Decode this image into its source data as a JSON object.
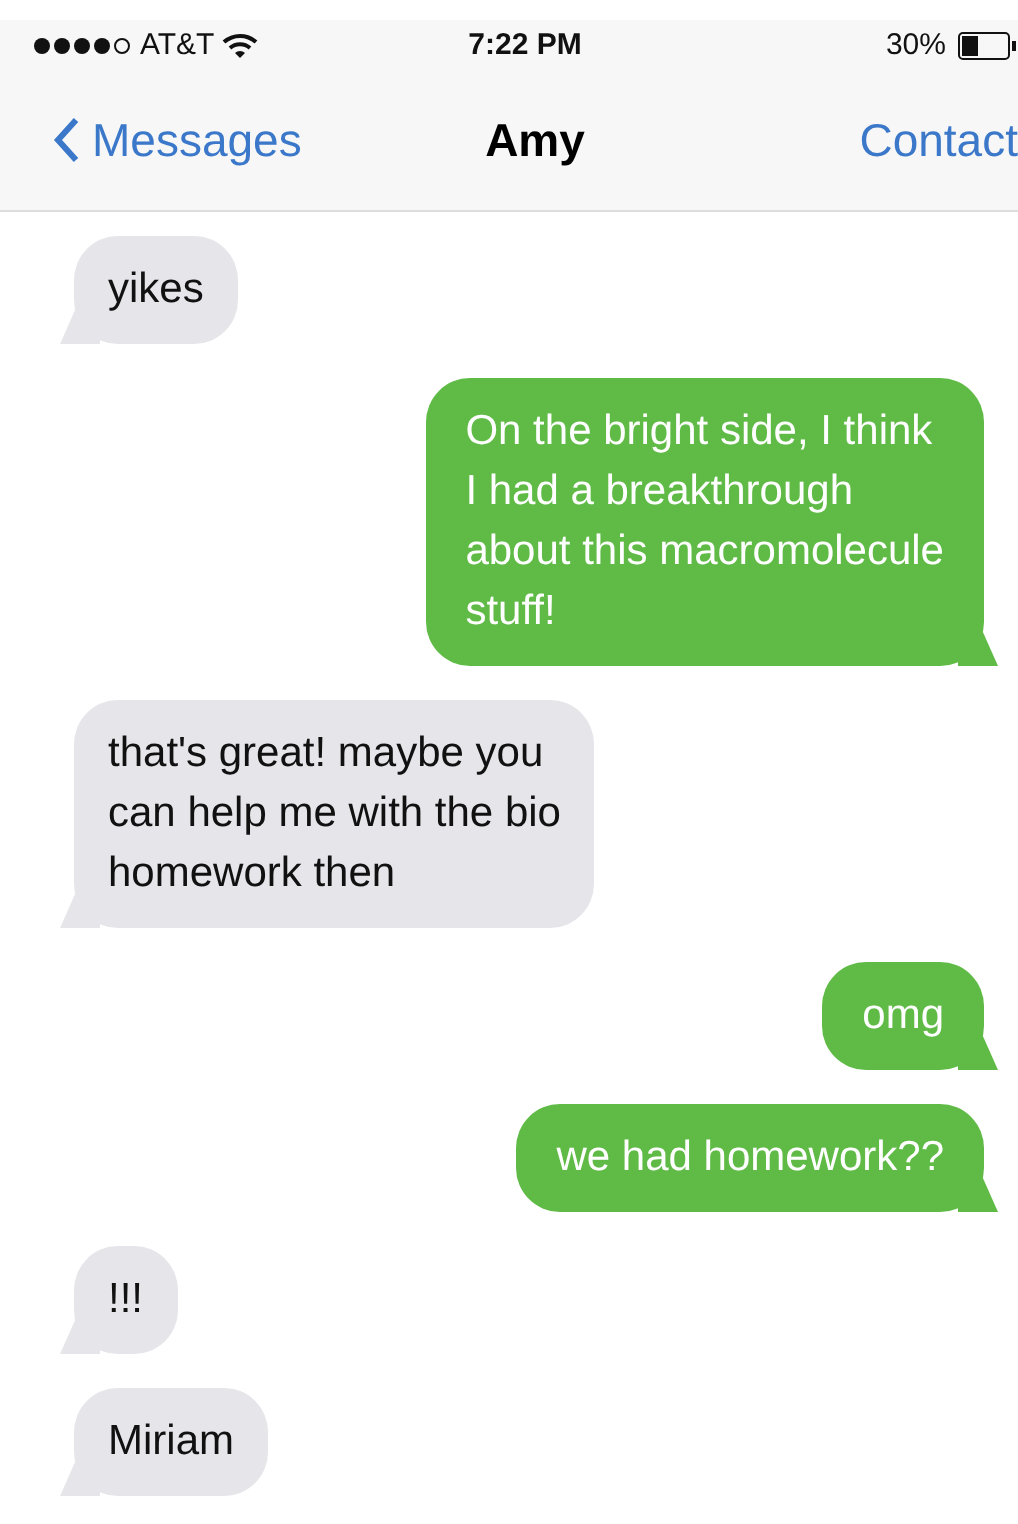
{
  "status_bar": {
    "carrier": "AT&T",
    "time": "7:22 PM",
    "battery": "30%"
  },
  "nav_bar": {
    "back": "Messages",
    "title": "Amy",
    "action": "Contact"
  },
  "messages": [
    {
      "kind": "received",
      "lines": [
        "yikes"
      ]
    },
    {
      "kind": "sent",
      "lines": [
        "On the bright side, I think",
        "I had a breakthrough",
        "about this macromolecule",
        "stuff!"
      ]
    },
    {
      "kind": "received",
      "lines": [
        "that's great! maybe you",
        "can help me with the bio",
        "homework then"
      ]
    },
    {
      "kind": "sent",
      "lines": [
        "omg"
      ]
    },
    {
      "kind": "sent",
      "lines": [
        "we had homework??"
      ]
    },
    {
      "kind": "received",
      "lines": [
        "!!!"
      ]
    },
    {
      "kind": "received",
      "lines": [
        "Miriam"
      ]
    }
  ]
}
